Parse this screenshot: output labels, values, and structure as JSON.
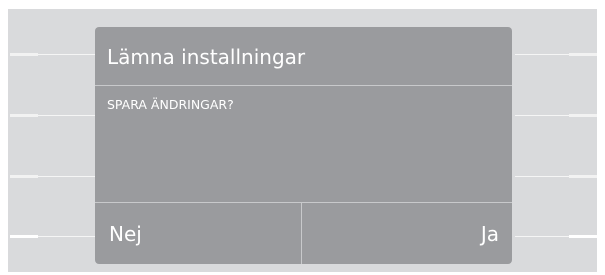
{
  "dialog": {
    "title": "Lämna installningar",
    "message": "SPARA ÄNDRINGAR?",
    "buttons": {
      "no": "Nej",
      "yes": "Ja"
    }
  },
  "colors": {
    "screen_background": "#d9dadc",
    "dialog_background": "#9a9b9e",
    "divider": "#c8c9cb",
    "text": "#ffffff"
  }
}
